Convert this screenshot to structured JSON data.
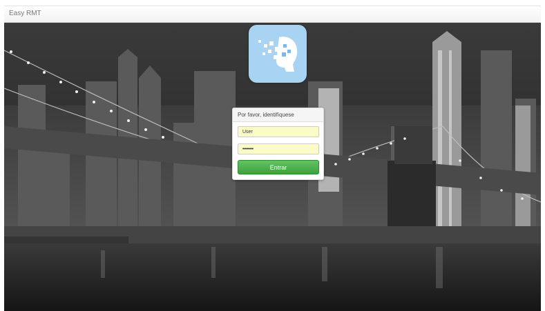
{
  "navbar": {
    "brand": "Easy RMT"
  },
  "background": {
    "description_icon": "city-skyline-photo"
  },
  "logo": {
    "icon": "head-profile-pixels-icon",
    "tile_color": "#a9d3f3"
  },
  "login": {
    "heading": "Por favor, identifíquese",
    "username_value": "User",
    "password_value": "••••••••",
    "submit_label": "Entrar",
    "field_color": "#fafbc6",
    "button_color": "#4cae4c"
  }
}
